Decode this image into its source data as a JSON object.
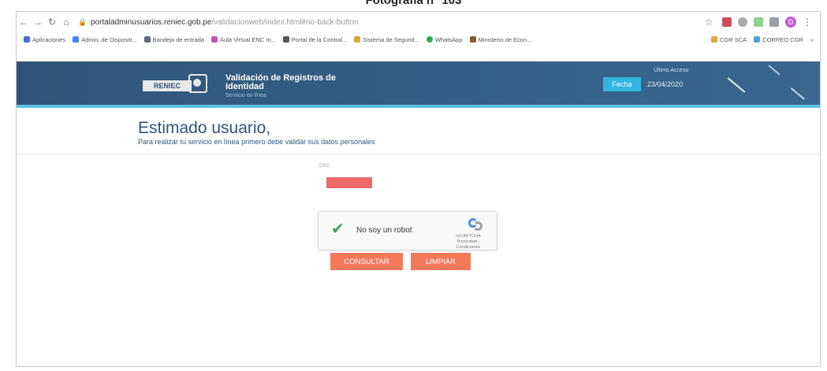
{
  "caption": "Fotografía n° 103",
  "browser": {
    "url_host": "portaladminusuarios.reniec.gob.pe",
    "url_path": "/validacionweb/index.html#no-back-button",
    "profile_initial": "D",
    "bookmarks": [
      {
        "label": "Aplicaciones",
        "color": "#4a6fd6"
      },
      {
        "label": "Admin. de Dispositi...",
        "color": "#4285f4"
      },
      {
        "label": "Bandeja de entrada",
        "color": "#5f6b7a"
      },
      {
        "label": "Aula Virtual ENC In...",
        "color": "#d04fb0"
      },
      {
        "label": "Portal de la Contral...",
        "color": "#555555"
      },
      {
        "label": "Sistema de Segurid...",
        "color": "#e0a33a"
      },
      {
        "label": "WhatsApp",
        "color": "#25b14a"
      },
      {
        "label": "Ministerio de Econ...",
        "color": "#8a5a2a"
      },
      {
        "label": "CGR SCA",
        "color": "#e7a13a"
      },
      {
        "label": "CORREO CGR",
        "color": "#4aa3df"
      }
    ],
    "bookmarks_more": "»"
  },
  "header": {
    "logo_text": "RENIEC",
    "title_line1": "Validación de Registros de",
    "title_line2": "Identidad",
    "subtitle": "Servicio en línea",
    "last_access_label": "Último Acceso",
    "date_label": "Fecha",
    "date_value": "23/04/2020"
  },
  "main": {
    "greeting": "Estimado usuario,",
    "instructions": "Para realizar tu servicio en línea primero debe validar sus datos personales",
    "dni_label": "DNI"
  },
  "captcha": {
    "label": "No soy un robot",
    "brand": "reCAPTCHA",
    "brand_links": "Privacidad - Condiciones"
  },
  "buttons": {
    "consult": "CONSULTAR",
    "clear": "LIMPIAR"
  },
  "colors": {
    "header_bg": "#355f86",
    "header_accent": "#5ec2e0",
    "button": "#f4795a",
    "dni_input": "#ef6b6b"
  }
}
